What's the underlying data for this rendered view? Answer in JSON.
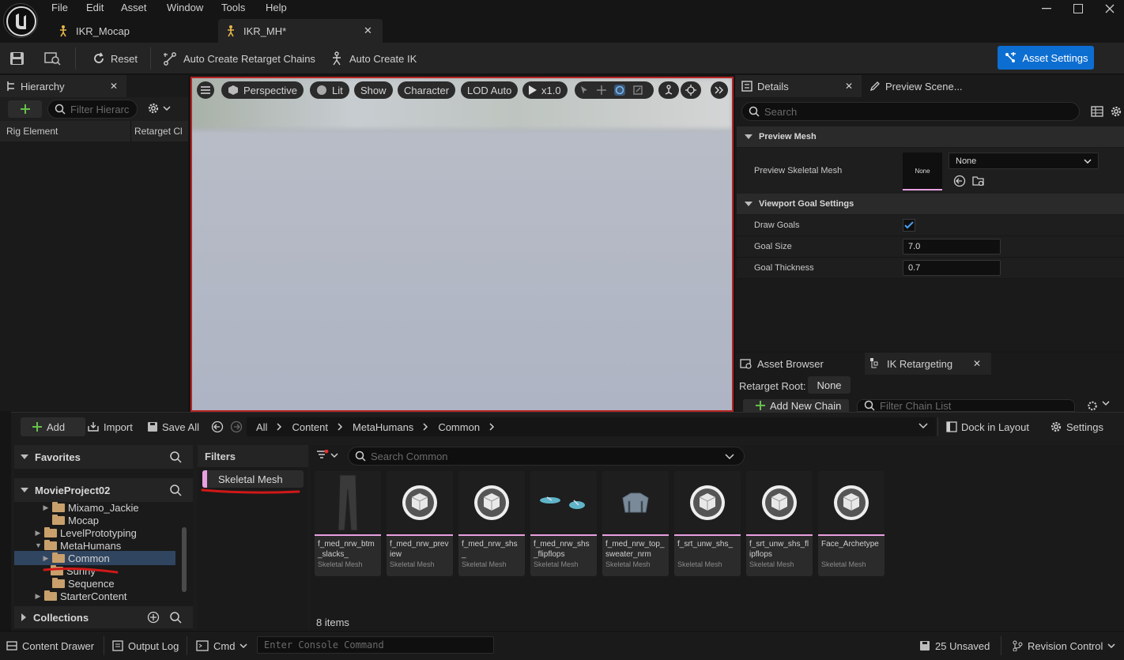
{
  "menu": [
    "File",
    "Edit",
    "Asset",
    "Window",
    "Tools",
    "Help"
  ],
  "tabs": [
    {
      "label": "IKR_Mocap"
    },
    {
      "label": "IKR_MH*"
    }
  ],
  "toolbar": {
    "reset": "Reset",
    "auto_chains": "Auto Create Retarget Chains",
    "auto_ik": "Auto Create IK",
    "asset_settings": "Asset Settings"
  },
  "hierarchy": {
    "title": "Hierarchy",
    "filter_placeholder": "Filter Hierarc",
    "col_rig": "Rig Element",
    "col_retarget": "Retarget Cl"
  },
  "viewport": {
    "perspective": "Perspective",
    "lit": "Lit",
    "show": "Show",
    "character": "Character",
    "lod": "LOD Auto",
    "speed": "x1.0"
  },
  "details": {
    "tab_details": "Details",
    "tab_preview": "Preview Scene...",
    "search_placeholder": "Search",
    "section_preview": "Preview Mesh",
    "preview_skel_label": "Preview Skeletal Mesh",
    "thumb_none": "None",
    "mesh_value": "None",
    "section_goal": "Viewport Goal Settings",
    "draw_goals": "Draw Goals",
    "goal_size_label": "Goal Size",
    "goal_size": "7.0",
    "goal_thickness_label": "Goal Thickness",
    "goal_thickness": "0.7"
  },
  "ik_panel": {
    "tab_asset_browser": "Asset Browser",
    "tab_ik_retargeting": "IK Retargeting",
    "retarget_root_label": "Retarget Root:",
    "retarget_root_value": "None",
    "add_chain": "Add New Chain",
    "filter_placeholder": "Filter Chain List"
  },
  "content_browser": {
    "add": "Add",
    "import": "Import",
    "save_all": "Save All",
    "breadcrumb": [
      "All",
      "Content",
      "MetaHumans",
      "Common"
    ],
    "dock": "Dock in Layout",
    "settings": "Settings",
    "favorites": "Favorites",
    "project": "MovieProject02",
    "tree": [
      {
        "label": "Mixamo_Jackie"
      },
      {
        "label": "Mocap"
      },
      {
        "label": "LevelPrototyping"
      },
      {
        "label": "MetaHumans"
      },
      {
        "label": "Common"
      },
      {
        "label": "Sunny"
      },
      {
        "label": "Sequence"
      },
      {
        "label": "StarterContent"
      }
    ],
    "collections": "Collections",
    "filters_title": "Filters",
    "filter_chip": "Skeletal Mesh",
    "search_placeholder": "Search Common",
    "item_count": "8 items",
    "assets": [
      {
        "name": "f_med_nrw_btm_slacks_",
        "type": "Skeletal Mesh",
        "icon": "pants-thumb"
      },
      {
        "name": "f_med_nrw_preview",
        "type": "Skeletal Mesh",
        "icon": "cube-icon"
      },
      {
        "name": "f_med_nrw_shs_",
        "type": "Skeletal Mesh",
        "icon": "cube-icon"
      },
      {
        "name": "f_med_nrw_shs_flipflops",
        "type": "Skeletal Mesh",
        "icon": "flipflops-thumb"
      },
      {
        "name": "f_med_nrw_top_sweater_nrm",
        "type": "Skeletal Mesh",
        "icon": "sweater-thumb"
      },
      {
        "name": "f_srt_unw_shs_",
        "type": "Skeletal Mesh",
        "icon": "cube-icon"
      },
      {
        "name": "f_srt_unw_shs_flipflops",
        "type": "Skeletal Mesh",
        "icon": "cube-icon"
      },
      {
        "name": "Face_Archetype",
        "type": "Skeletal Mesh",
        "icon": "cube-icon"
      }
    ]
  },
  "statusbar": {
    "content_drawer": "Content Drawer",
    "output_log": "Output Log",
    "cmd": "Cmd",
    "console_placeholder": "Enter Console Command",
    "unsaved": "25 Unsaved",
    "revision": "Revision Control"
  },
  "colors": {
    "accent": "#0d6ed1",
    "viewport_border": "#b82424",
    "asset_bar": "#e8a0e0",
    "annotation": "#d01818"
  }
}
